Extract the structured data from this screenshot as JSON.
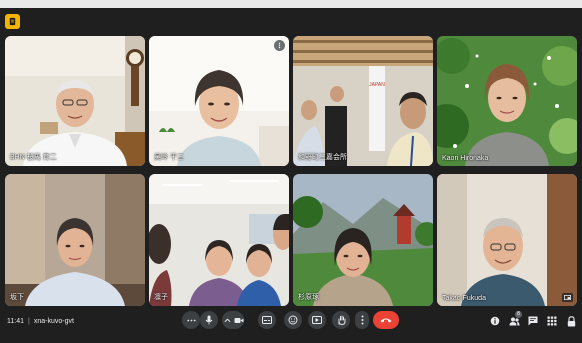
{
  "meeting": {
    "time": "11:41",
    "separator": "|",
    "code": "xna-kuvo-gvt"
  },
  "participants": [
    {
      "name": "BHN 桜馬 育二"
    },
    {
      "name": "吴岭 干三"
    },
    {
      "name": "和野町三嘉会所"
    },
    {
      "name": "Kaori Hironaka"
    },
    {
      "name": "坂下"
    },
    {
      "name": "凛子"
    },
    {
      "name": "杉原琢"
    },
    {
      "name": "Takao Fukuda"
    }
  ],
  "toolbar": {
    "more_options_label": "⋯",
    "participants_count": "8"
  },
  "colors": {
    "background": "#1f1f1f",
    "control": "#3c4043",
    "end_call": "#ea4335",
    "logo": "#f4b400"
  },
  "icons": [
    "mic-icon",
    "chevron-up-icon",
    "camera-icon",
    "captions-icon",
    "emoji-icon",
    "present-icon",
    "raise-hand-icon",
    "more-vert-icon",
    "end-call-icon",
    "info-icon",
    "people-icon",
    "chat-icon",
    "activities-icon",
    "lock-icon"
  ]
}
